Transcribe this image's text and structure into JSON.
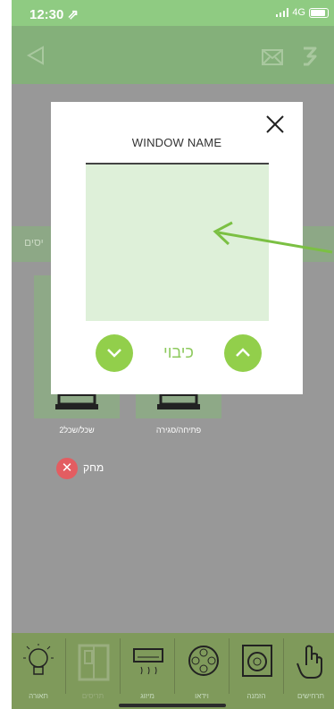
{
  "status_bar": {
    "time": "12:30 ⇗",
    "network": "4G"
  },
  "top_bar": {
    "back_icon": "back-triangle-icon",
    "mail_icon": "envelope-icon",
    "menu_icon": "menu-icon"
  },
  "background": {
    "band_label": "יסים",
    "cards": [
      {
        "label": "שכל/שכל2"
      },
      {
        "label": "פתיחה/סגירה"
      }
    ],
    "delete_label": "מחק",
    "delete_icon": "x-icon"
  },
  "modal": {
    "title": "WINDOW NAME",
    "close_icon": "close-x-icon",
    "control_label": "כיבוי",
    "down_icon": "chevron-down-icon",
    "up_icon": "chevron-up-icon"
  },
  "bottom_nav": {
    "items": [
      {
        "label": "תאורה",
        "icon": "lightbulb-icon"
      },
      {
        "label": "תריסים",
        "icon": "shutter-icon"
      },
      {
        "label": "מיזוג",
        "icon": "air-conditioner-icon"
      },
      {
        "label": "וידאו",
        "icon": "film-reel-icon"
      },
      {
        "label": "הזמנה",
        "icon": "speaker-icon"
      },
      {
        "label": "תרחישים",
        "icon": "hand-pointer-icon"
      }
    ]
  },
  "colors": {
    "accent_green": "#92cf4b",
    "status_green": "#8fcb82",
    "nav_green": "#7f9a5b",
    "delete_red": "#e35d61",
    "preview_green": "#def0d9"
  }
}
